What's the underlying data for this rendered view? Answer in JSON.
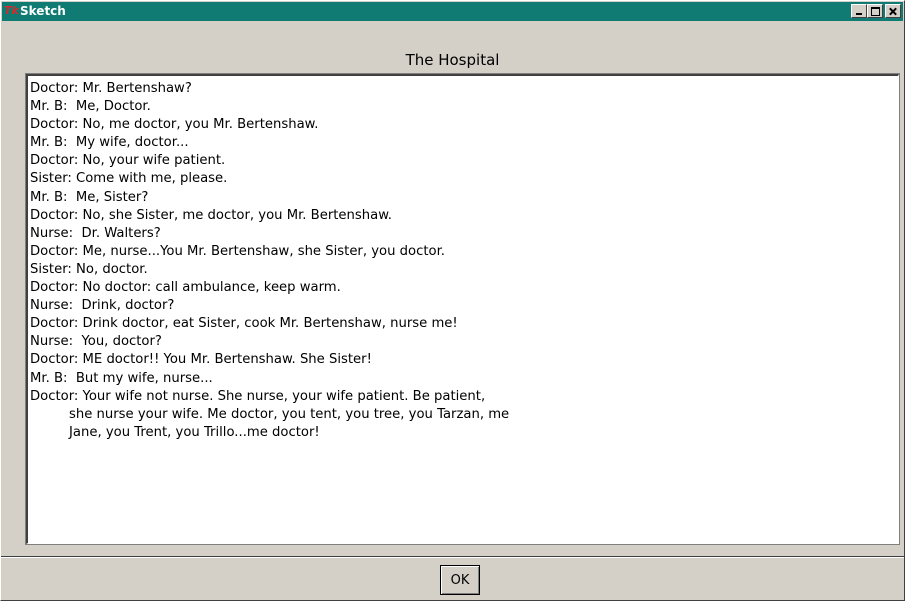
{
  "window": {
    "title": "Sketch",
    "icon": "tk-app-icon"
  },
  "dialog": {
    "heading": "The Hospital",
    "lines": [
      "Doctor: Mr. Bertenshaw?",
      "Mr. B:  Me, Doctor.",
      "Doctor: No, me doctor, you Mr. Bertenshaw.",
      "Mr. B:  My wife, doctor...",
      "Doctor: No, your wife patient.",
      "Sister: Come with me, please.",
      "Mr. B:  Me, Sister?",
      "Doctor: No, she Sister, me doctor, you Mr. Bertenshaw.",
      "Nurse:  Dr. Walters?",
      "Doctor: Me, nurse...You Mr. Bertenshaw, she Sister, you doctor.",
      "Sister: No, doctor.",
      "Doctor: No doctor: call ambulance, keep warm.",
      "Nurse:  Drink, doctor?",
      "Doctor: Drink doctor, eat Sister, cook Mr. Bertenshaw, nurse me!",
      "Nurse:  You, doctor?",
      "Doctor: ME doctor!! You Mr. Bertenshaw. She Sister!",
      "Mr. B:  But my wife, nurse...",
      "Doctor: Your wife not nurse. She nurse, your wife patient. Be patient,",
      "she nurse your wife. Me doctor, you tent, you tree, you Tarzan, me",
      "Jane, you Trent, you Trillo...me doctor!"
    ],
    "ok_label": "OK"
  }
}
